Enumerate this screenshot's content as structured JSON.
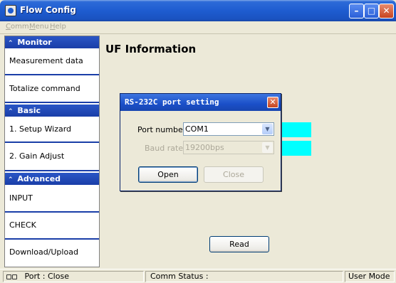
{
  "window": {
    "title": "Flow Config",
    "controls": {
      "minimize": "–",
      "maximize": "□",
      "close": "✕"
    }
  },
  "menubar": {
    "items": [
      "Comm",
      "Menu",
      "Help"
    ]
  },
  "sidebar": {
    "sections": [
      {
        "header": "Monitor",
        "items": [
          "Measurement data",
          "Totalize command"
        ]
      },
      {
        "header": "Basic",
        "items": [
          "1. Setup Wizard",
          "2. Gain Adjust"
        ]
      },
      {
        "header": "Advanced",
        "items": [
          "INPUT",
          "CHECK",
          "Download/Upload"
        ]
      }
    ],
    "chevron": "⌃"
  },
  "main": {
    "title": "UF Information",
    "read_button": "Read",
    "read_button_accel": "R"
  },
  "dialog": {
    "title": "RS-232C port setting",
    "port_label": "Port number",
    "port_value": "COM1",
    "baud_label": "Baud rate",
    "baud_value": "19200bps",
    "open_button": "Open",
    "close_button": "Close",
    "close_icon": "✕"
  },
  "statusbar": {
    "port": "Port : Close",
    "comm": "Comm Status :",
    "mode": "User Mode"
  },
  "colors": {
    "accent": "#1A3EA8",
    "highlight": "#00FFFF"
  }
}
